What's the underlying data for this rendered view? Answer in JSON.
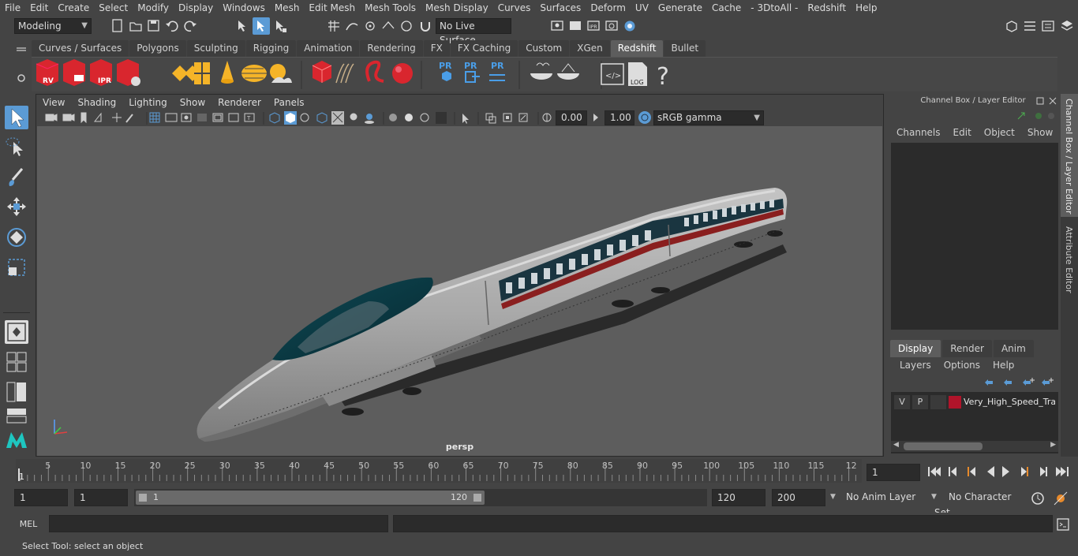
{
  "menubar": [
    "File",
    "Edit",
    "Create",
    "Select",
    "Modify",
    "Display",
    "Windows",
    "Mesh",
    "Edit Mesh",
    "Mesh Tools",
    "Mesh Display",
    "Curves",
    "Surfaces",
    "Deform",
    "UV",
    "Generate",
    "Cache",
    "- 3DtoAll -",
    "Redshift",
    "Help"
  ],
  "statusline": {
    "workspace": "Modeling",
    "live_surface": "No Live Surface"
  },
  "shelf_tabs": [
    "Curves / Surfaces",
    "Polygons",
    "Sculpting",
    "Rigging",
    "Animation",
    "Rendering",
    "FX",
    "FX Caching",
    "Custom",
    "XGen",
    "Redshift",
    "Bullet"
  ],
  "shelf_active": "Redshift",
  "shelf_icons": {
    "rv": "RV",
    "ipr": "IPR",
    "pr1": "PR",
    "pr2": "PR",
    "pr3": "PR",
    "log": "LOG",
    "help": "?"
  },
  "viewport": {
    "menus": [
      "View",
      "Shading",
      "Lighting",
      "Show",
      "Renderer",
      "Panels"
    ],
    "exposure": "0.00",
    "gamma": "1.00",
    "color_space": "sRGB gamma",
    "camera_label": "persp"
  },
  "channel_box": {
    "title": "Channel Box / Layer Editor",
    "menus": [
      "Channels",
      "Edit",
      "Object",
      "Show"
    ]
  },
  "layer_editor": {
    "tabs": [
      "Display",
      "Render",
      "Anim"
    ],
    "active_tab": "Display",
    "menus": [
      "Layers",
      "Options",
      "Help"
    ],
    "layer": {
      "v": "V",
      "p": "P",
      "name": "Very_High_Speed_Train",
      "color": "#b0142a"
    }
  },
  "side_tabs": [
    "Channel Box / Layer Editor",
    "Attribute Editor"
  ],
  "timeline": {
    "ticks": [
      "5",
      "10",
      "15",
      "20",
      "25",
      "30",
      "35",
      "40",
      "45",
      "50",
      "55",
      "60",
      "65",
      "70",
      "75",
      "80",
      "85",
      "90",
      "95",
      "100",
      "105",
      "110",
      "115",
      "12"
    ],
    "start_marker": "1",
    "current_frame": "1"
  },
  "range": {
    "start": "1",
    "playback_start": "1",
    "slider_start": "1",
    "slider_end": "120",
    "playback_end": "120",
    "end": "200",
    "anim_layer": "No Anim Layer",
    "character_set": "No Character Set"
  },
  "command_line": {
    "label": "MEL"
  },
  "help_line": "Select Tool: select an object",
  "colors": {
    "accent": "#5b9bd5",
    "panel": "#444444",
    "viewport_bg": "#5d5d5d",
    "redshift_red": "#d9262e"
  }
}
